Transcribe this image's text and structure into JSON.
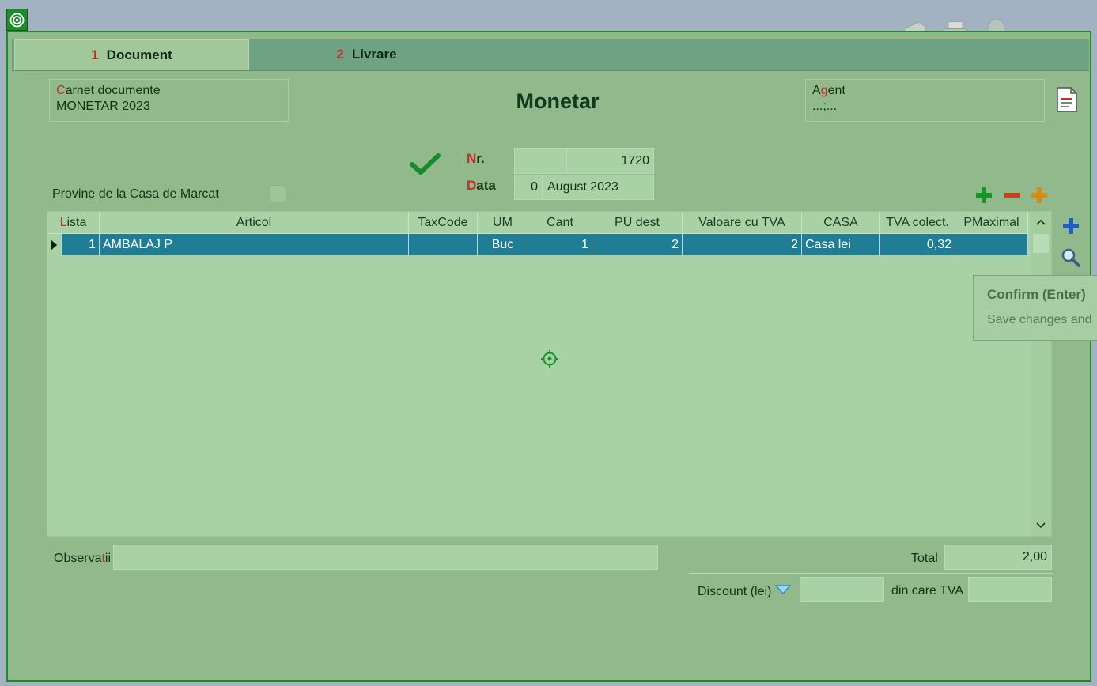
{
  "tabs": [
    {
      "num": "1",
      "label": "Document"
    },
    {
      "num": "2",
      "label": "Livrare"
    }
  ],
  "carnet": {
    "label_first": "C",
    "label_rest": "arnet documente",
    "value": "MONETAR 2023"
  },
  "title": "Monetar",
  "agent": {
    "label_a": "A",
    "label_g": "g",
    "label_rest": "ent",
    "value": "...;..."
  },
  "nr": {
    "label_red": "N",
    "label_rest": "r.",
    "prefix": "",
    "value": "1720"
  },
  "data": {
    "label_red": "D",
    "label_rest": "ata",
    "day": "0",
    "month": "August 2023"
  },
  "casa_marcat": {
    "label": "Provine de la Casa de Marcat",
    "checked": false
  },
  "grid": {
    "columns": [
      {
        "key": "lista",
        "label_red": "L",
        "label_rest": "ista"
      },
      {
        "key": "articol",
        "label": "Articol"
      },
      {
        "key": "taxcode",
        "label": "TaxCode"
      },
      {
        "key": "um",
        "label": "UM"
      },
      {
        "key": "cant",
        "label": "Cant"
      },
      {
        "key": "pu",
        "label": "PU dest"
      },
      {
        "key": "val",
        "label": "Valoare cu TVA"
      },
      {
        "key": "casa",
        "label": "CASA"
      },
      {
        "key": "tva",
        "label": "TVA colect."
      },
      {
        "key": "pmax",
        "label": "PMaximal"
      }
    ],
    "rows": [
      {
        "lista": "1",
        "articol": "AMBALAJ P",
        "taxcode": "",
        "um": "Buc",
        "cant": "1",
        "pu": "2",
        "val": "2",
        "casa": "Casa lei",
        "tva": "0,32",
        "pmax": ""
      }
    ]
  },
  "tooltip": {
    "title": "Confirm (Enter)",
    "body": "Save changes and"
  },
  "observatii": {
    "label_a": "Observa",
    "label_t": "t",
    "label_b": "ii",
    "value": ""
  },
  "total": {
    "label": "Total",
    "value": "2,00"
  },
  "discount": {
    "label": "Discount (lei)",
    "value": ""
  },
  "din_care_tva": {
    "label": "din care TVA",
    "value": ""
  },
  "colors": {
    "accent_green": "#1f8a2a",
    "selection": "#1f7e96",
    "accent_red": "#c0312a"
  }
}
